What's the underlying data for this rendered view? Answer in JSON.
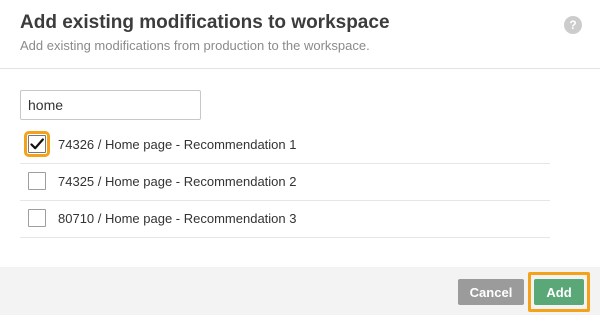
{
  "dialog": {
    "title": "Add existing modifications to workspace",
    "subtitle": "Add existing modifications from production to the workspace.",
    "help_icon": "?"
  },
  "search": {
    "value": "home",
    "placeholder": ""
  },
  "items": [
    {
      "label": "74326 / Home page - Recommendation 1",
      "checked": true
    },
    {
      "label": "74325 / Home page - Recommendation 2",
      "checked": false
    },
    {
      "label": "80710 / Home page - Recommendation 3",
      "checked": false
    }
  ],
  "footer": {
    "cancel_label": "Cancel",
    "add_label": "Add"
  },
  "colors": {
    "highlight": "#f4a21a",
    "add_button": "#5aa878",
    "cancel_button": "#9b9b9b"
  },
  "icons": {
    "help": "question-mark-circle",
    "check": "checkmark"
  }
}
